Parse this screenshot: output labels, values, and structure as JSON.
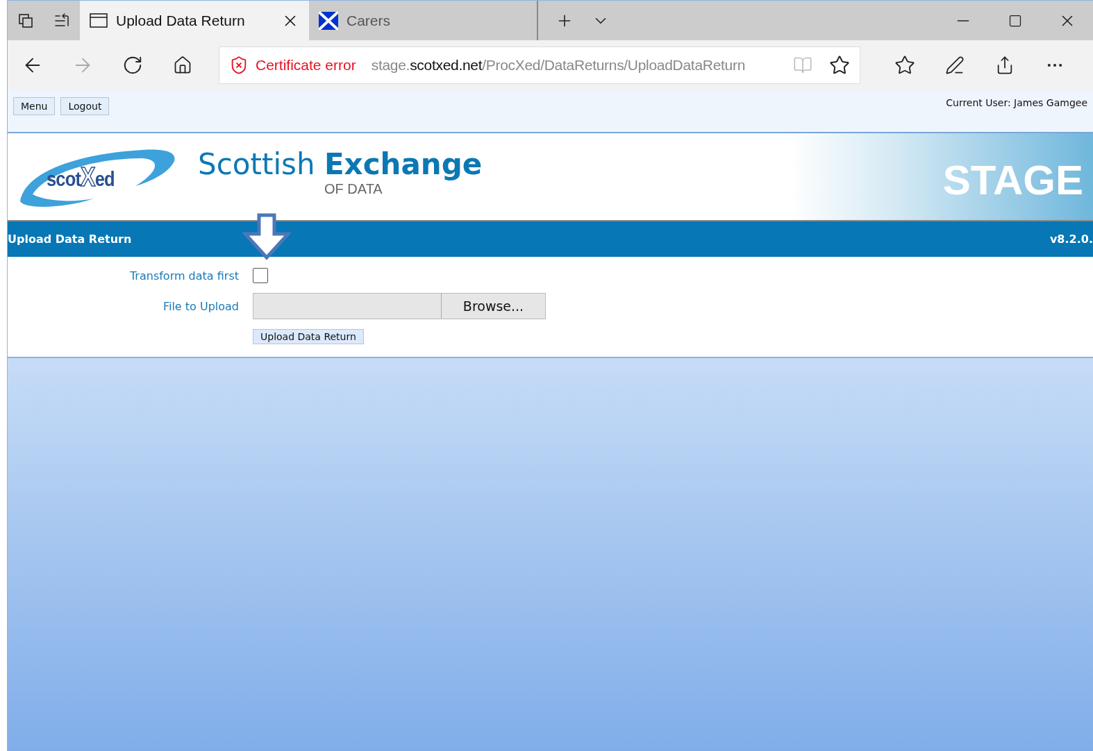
{
  "browser": {
    "tabs": [
      {
        "title": "Upload Data Return",
        "selected": true
      },
      {
        "title": "Carers",
        "selected": false
      }
    ],
    "address": {
      "security": "Certificate error",
      "url_prefix": "stage.",
      "url_domain": "scotxed.net",
      "url_path": "/ProcXed/DataReturns/UploadDataReturn"
    }
  },
  "top_bar": {
    "buttons": [
      "Menu",
      "Logout"
    ],
    "current_user": "Current User: James Gamgee"
  },
  "header": {
    "logo": {
      "left": "scot",
      "mark": "X",
      "right": "ed"
    },
    "title_light": "Scottish",
    "title_bold": "Exchange",
    "subtitle": "OF DATA",
    "environment": "STAGE"
  },
  "section": {
    "title": "Upload Data Return",
    "version": "v8.2.0."
  },
  "form": {
    "fields": [
      {
        "kind": "checkbox",
        "label": "Transform data first",
        "checked": false
      },
      {
        "kind": "file",
        "label": "File to Upload",
        "button": "Browse..."
      }
    ],
    "submit": "Upload Data Return"
  }
}
